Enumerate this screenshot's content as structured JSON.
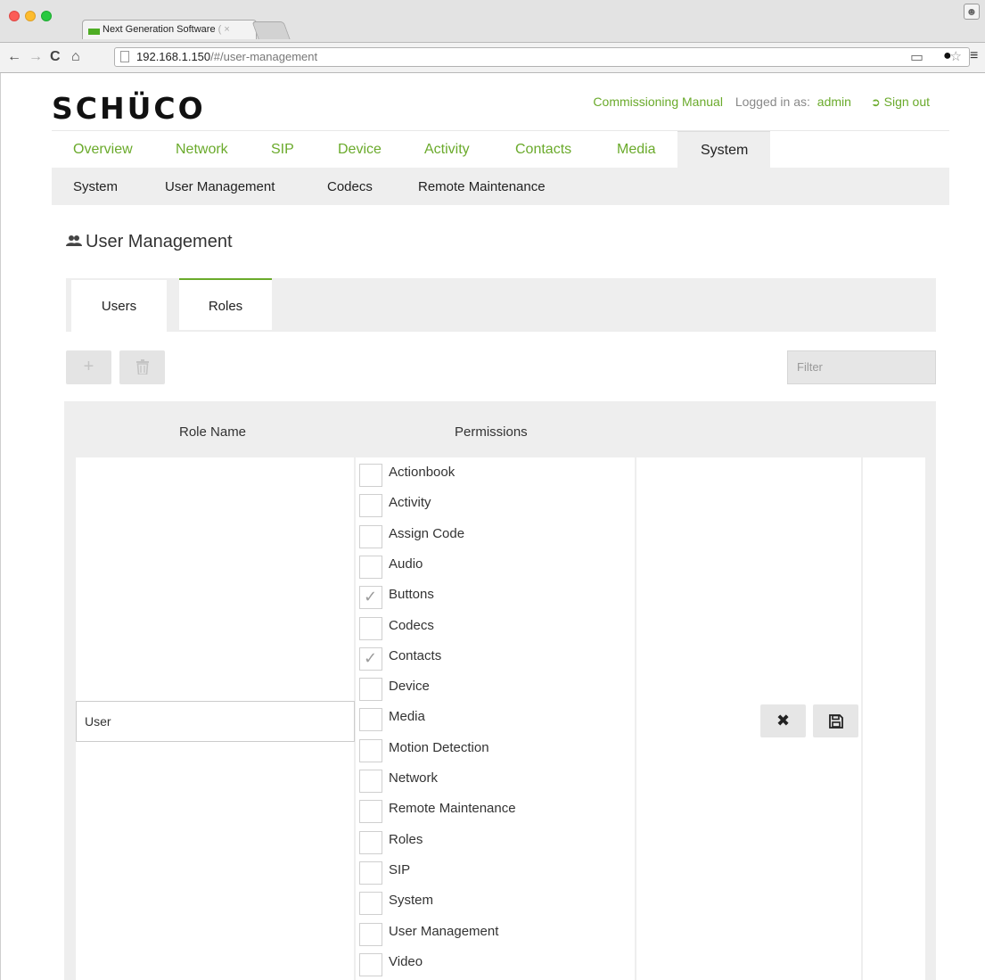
{
  "browser": {
    "tab_title": "Next Generation Software",
    "tab_title_tail": "( ×",
    "url_host": "192.168.1.150",
    "url_path": "/#/user-management"
  },
  "header": {
    "logo": "SCHÜCO",
    "manual_link": "Commissioning Manual",
    "logged_in_label": "Logged in as:",
    "username": "admin",
    "sign_out": "Sign out"
  },
  "main_nav": [
    {
      "label": "Overview"
    },
    {
      "label": "Network"
    },
    {
      "label": "SIP"
    },
    {
      "label": "Device"
    },
    {
      "label": "Activity"
    },
    {
      "label": "Contacts"
    },
    {
      "label": "Media"
    },
    {
      "label": "System",
      "active": true
    }
  ],
  "sub_nav": [
    {
      "label": "System"
    },
    {
      "label": "User Management"
    },
    {
      "label": "Codecs"
    },
    {
      "label": "Remote Maintenance"
    }
  ],
  "page_title": "User Management",
  "tabs": [
    {
      "label": "Users"
    },
    {
      "label": "Roles",
      "active": true
    }
  ],
  "filter_placeholder": "Filter",
  "table": {
    "columns": [
      "Role Name",
      "Permissions"
    ],
    "role_name_value": "User",
    "permissions": [
      {
        "label": "Actionbook",
        "checked": false
      },
      {
        "label": "Activity",
        "checked": false
      },
      {
        "label": "Assign Code",
        "checked": false
      },
      {
        "label": "Audio",
        "checked": false
      },
      {
        "label": "Buttons",
        "checked": true
      },
      {
        "label": "Codecs",
        "checked": false
      },
      {
        "label": "Contacts",
        "checked": true
      },
      {
        "label": "Device",
        "checked": false
      },
      {
        "label": "Media",
        "checked": false
      },
      {
        "label": "Motion Detection",
        "checked": false
      },
      {
        "label": "Network",
        "checked": false
      },
      {
        "label": "Remote Maintenance",
        "checked": false
      },
      {
        "label": "Roles",
        "checked": false
      },
      {
        "label": "SIP",
        "checked": false
      },
      {
        "label": "System",
        "checked": false
      },
      {
        "label": "User Management",
        "checked": false
      },
      {
        "label": "Video",
        "checked": false
      }
    ]
  },
  "colors": {
    "accent": "#6aaa2b",
    "panel": "#eeeeee"
  },
  "icons": {
    "add": "plus-icon",
    "delete": "trash-icon",
    "cancel": "close-icon",
    "save": "floppy-disk-icon",
    "users": "users-icon",
    "sign_out": "sign-out-icon"
  }
}
